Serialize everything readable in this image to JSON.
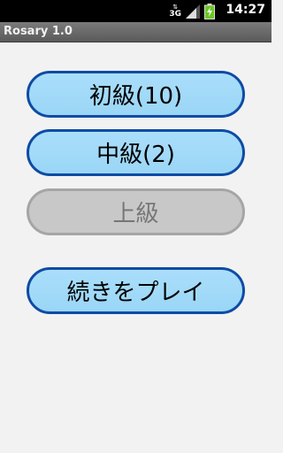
{
  "status_bar": {
    "network_type": "3G",
    "time": "14:27",
    "icons": [
      "data-activity-icon",
      "signal-icon",
      "battery-charging-icon"
    ]
  },
  "title_bar": {
    "title": "Rosary 1.0"
  },
  "menu": {
    "beginner_label": "初級(10)",
    "intermediate_label": "中級(2)",
    "advanced_label": "上級",
    "continue_label": "続きをプレイ"
  },
  "colors": {
    "button_fill": "#a6dcf9",
    "button_border": "#0e4ba4",
    "disabled_fill": "#c8c8c8",
    "disabled_border": "#a5a5a5",
    "disabled_text": "#777777",
    "background": "#f2f2f2"
  }
}
